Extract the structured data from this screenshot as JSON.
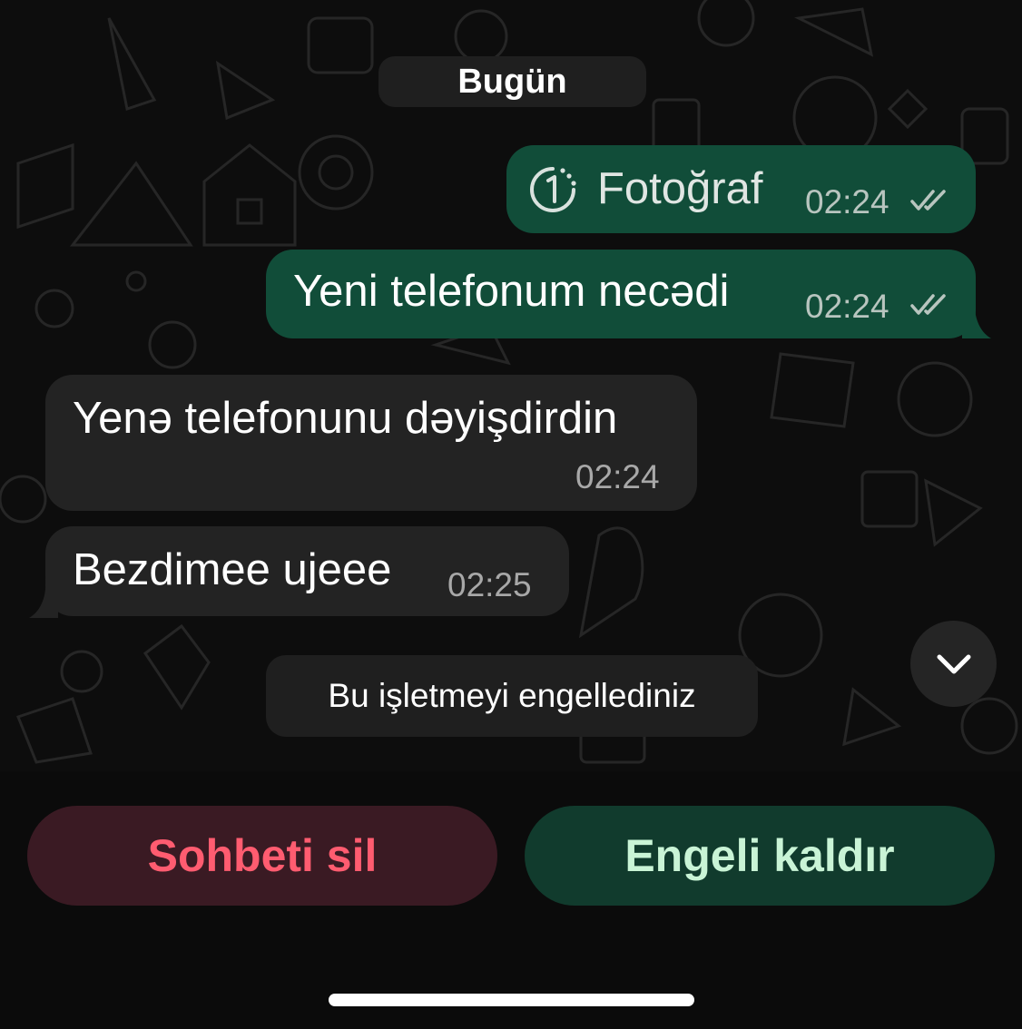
{
  "chat": {
    "date_divider": "Bugün",
    "messages": [
      {
        "direction": "outgoing",
        "type": "view-once-photo",
        "text": "Fotoğraf",
        "time": "02:24",
        "status_icon": "double-check-icon"
      },
      {
        "direction": "outgoing",
        "type": "text",
        "text": "Yeni telefonum necədi",
        "time": "02:24",
        "status_icon": "double-check-icon"
      },
      {
        "direction": "incoming",
        "type": "text",
        "text": "Yenə telefonunu dəyişdirdin",
        "time": "02:24"
      },
      {
        "direction": "incoming",
        "type": "text",
        "text": "Bezdimee ujeee",
        "time": "02:25"
      }
    ],
    "system_notice": "Bu işletmeyi engellediniz",
    "scroll_button_icon": "chevron-down-icon"
  },
  "actions": {
    "delete_label": "Sohbeti sil",
    "unblock_label": "Engeli kaldır"
  },
  "colors": {
    "outgoing_bubble": "#114d39",
    "incoming_bubble": "#232323",
    "delete_text": "#ff5c70",
    "unblock_text": "#c9f4d6"
  }
}
